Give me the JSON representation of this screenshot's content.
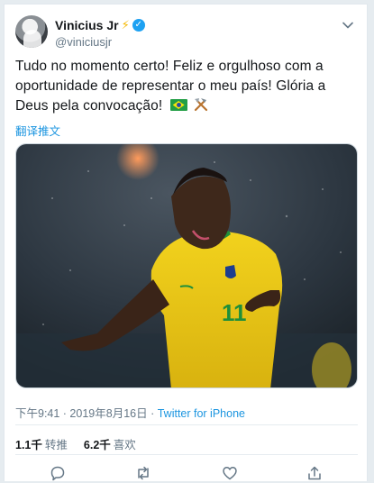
{
  "tweet": {
    "display_name": "Vinicius Jr",
    "handle": "@viniciusjr",
    "bolt_icon": "⚡",
    "verified_icon": "✓",
    "text_main": "Tudo no momento certo! Feliz e orgulhoso com a oportunidade de representar o meu país! Glória a Deus pela convocação!",
    "emojis": [
      "brazil-flag",
      "hammer-and-pick"
    ],
    "translate_label": "翻译推文",
    "time": "下午9:41 · 2019年8月16日",
    "separator": " · ",
    "source": "Twitter for iPhone",
    "retweets_count": "1.1千",
    "retweets_label": "转推",
    "likes_count": "6.2千",
    "likes_label": "喜欢"
  },
  "colors": {
    "link": "#1b95e0",
    "verified": "#1da1f2",
    "muted": "#657786",
    "text": "#14171a"
  },
  "icons": [
    "chevron-down-icon",
    "reply-icon",
    "retweet-icon",
    "like-icon",
    "share-icon"
  ]
}
